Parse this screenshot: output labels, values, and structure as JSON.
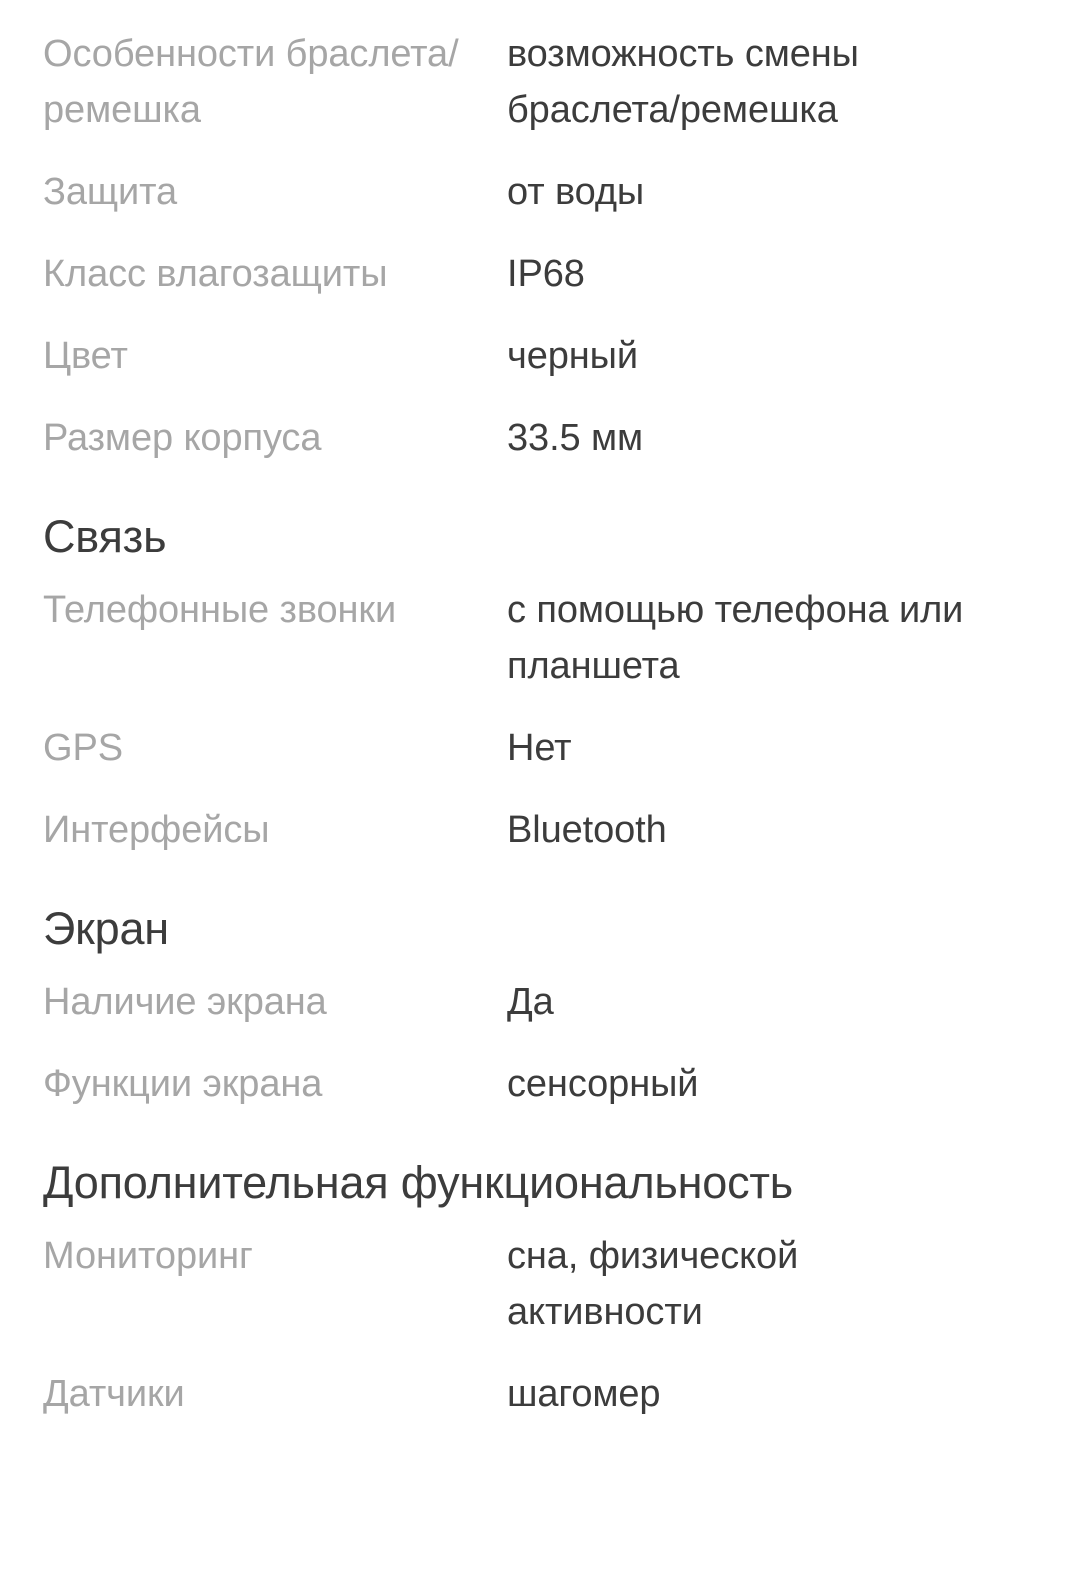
{
  "page": {
    "background_color": "#ffffff",
    "label_color": "#a6a6a6",
    "value_color": "#3c3c3c",
    "heading_color": "#3c3c3c"
  },
  "spec_blocks": [
    {
      "type": "rows",
      "rows": [
        {
          "label": "Особенности браслета/ремешка",
          "value": "возможность смены браслета/ремешка"
        },
        {
          "label": "Защита",
          "value": "от воды"
        },
        {
          "label": "Класс влагозащиты",
          "value": "IP68"
        },
        {
          "label": "Цвет",
          "value": "черный"
        },
        {
          "label": "Размер корпуса",
          "value": "33.5 мм"
        }
      ]
    },
    {
      "type": "section",
      "heading": "Связь",
      "rows": [
        {
          "label": "Телефонные звонки",
          "value": "с помощью телефона или планшета"
        },
        {
          "label": "GPS",
          "value": "Нет"
        },
        {
          "label": "Интерфейсы",
          "value": "Bluetooth"
        }
      ]
    },
    {
      "type": "section",
      "heading": "Экран",
      "rows": [
        {
          "label": "Наличие экрана",
          "value": "Да"
        },
        {
          "label": "Функции экрана",
          "value": "сенсорный"
        }
      ]
    },
    {
      "type": "section",
      "heading": "Дополнительная функциональность",
      "rows": [
        {
          "label": "Мониторинг",
          "value": "сна, физической активности"
        },
        {
          "label": "Датчики",
          "value": "шагомер"
        }
      ]
    }
  ]
}
